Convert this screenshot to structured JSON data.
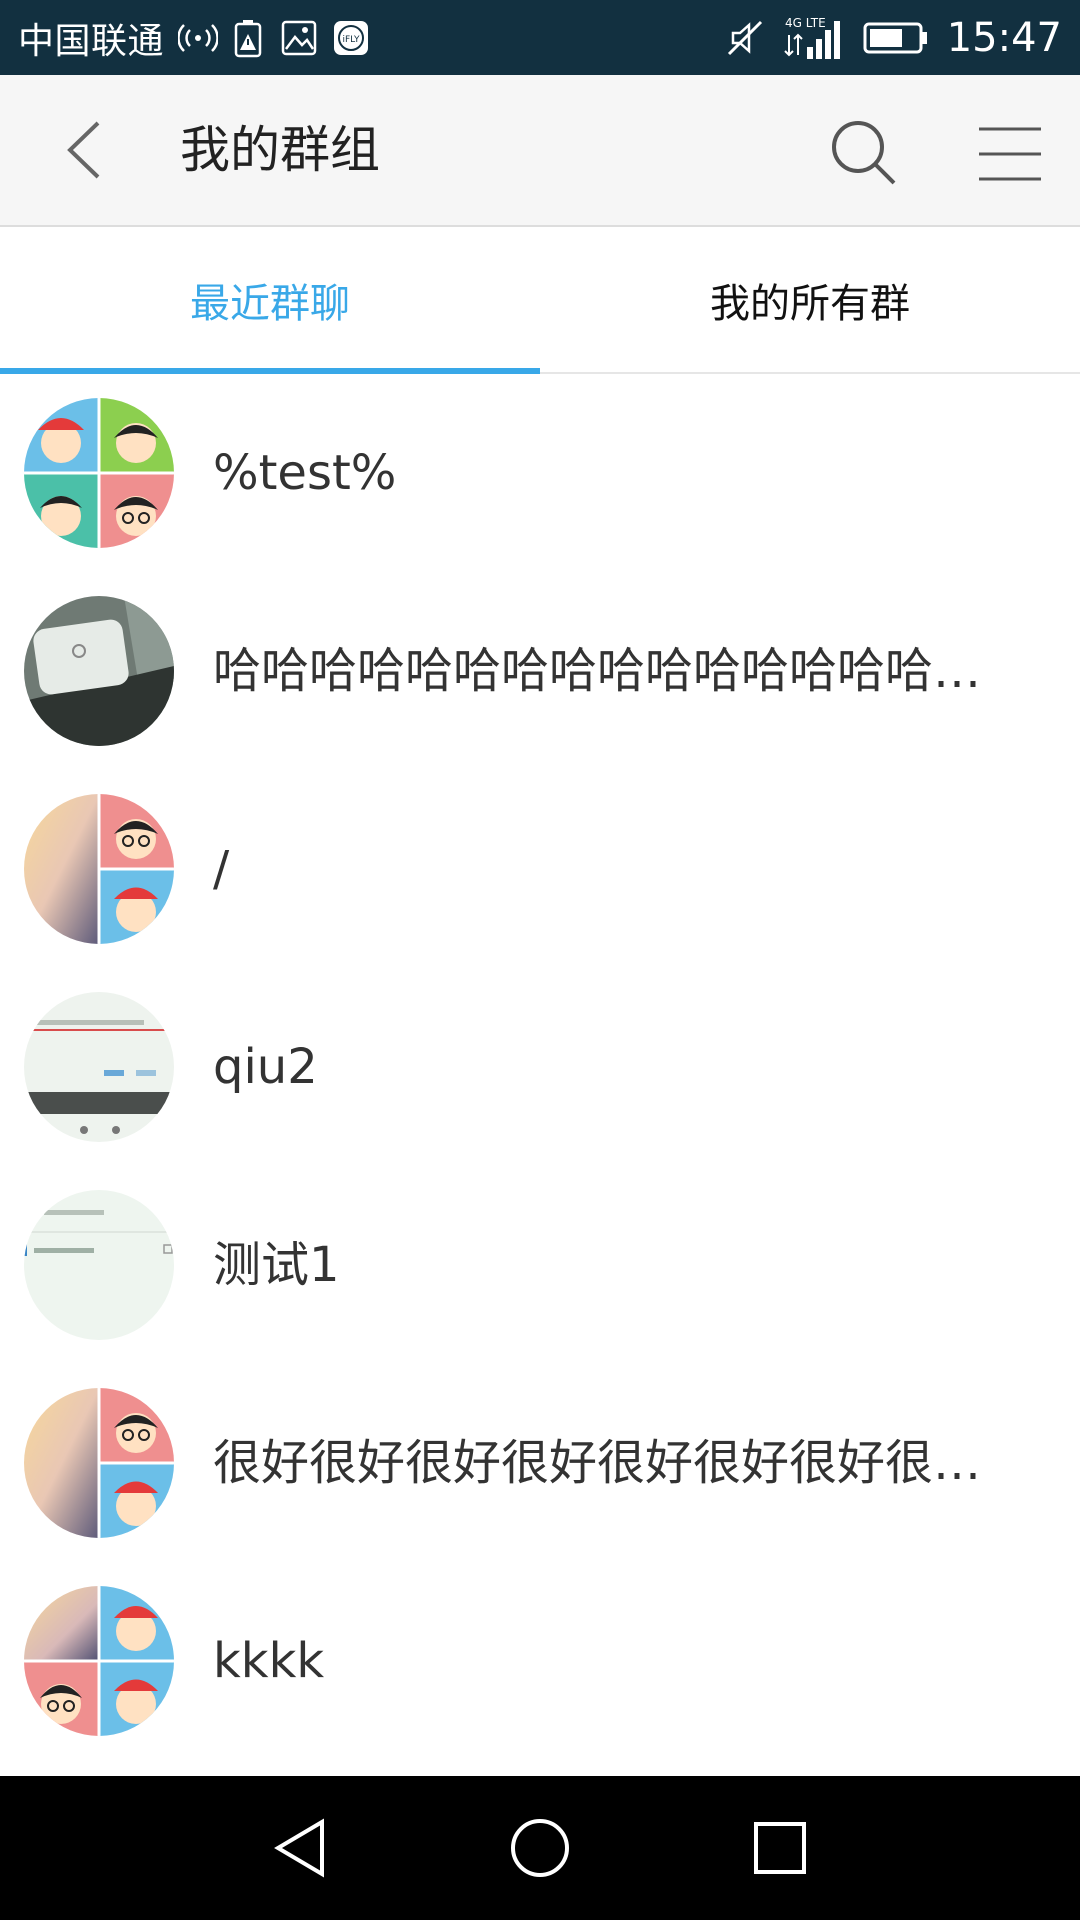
{
  "status_bar": {
    "carrier": "中国联通",
    "network": "4G LTE",
    "time": "15:47",
    "icons": [
      "broadcast-icon",
      "battery-warning-icon",
      "gallery-icon",
      "ifly-icon",
      "mute-icon",
      "signal-icon",
      "battery-icon"
    ],
    "ifly_label": "iFLY"
  },
  "app_bar": {
    "title": "我的群组",
    "icons": [
      "back-arrow-icon",
      "search-icon",
      "menu-icon"
    ]
  },
  "tabs": [
    {
      "label": "最近群聊",
      "active": true
    },
    {
      "label": "我的所有群",
      "active": false
    }
  ],
  "groups": [
    {
      "name": "%test%",
      "avatar": "four-cartoon-avatar-collage"
    },
    {
      "name": "哈哈哈哈哈哈哈哈哈哈哈哈哈哈哈哈哈哈哈哈",
      "avatar": "router-photo"
    },
    {
      "name": "/",
      "avatar": "sunset-and-cartoon-collage"
    },
    {
      "name": "qiu2",
      "avatar": "screenshot-thumbnail"
    },
    {
      "name": "测试1",
      "avatar": "screenshot-thumbnail-light"
    },
    {
      "name": "很好很好很好很好很好很好很好很好很好",
      "avatar": "sunset-and-cartoon-collage"
    },
    {
      "name": "kkkk",
      "avatar": "mixed-four-collage"
    }
  ],
  "nav_bar": {
    "icons": [
      "nav-back-icon",
      "nav-home-icon",
      "nav-recents-icon"
    ]
  },
  "colors": {
    "status_bar": "#123040",
    "accent": "#39a8e8",
    "app_bar": "#f6f6f6",
    "nav_bar": "#000000"
  }
}
